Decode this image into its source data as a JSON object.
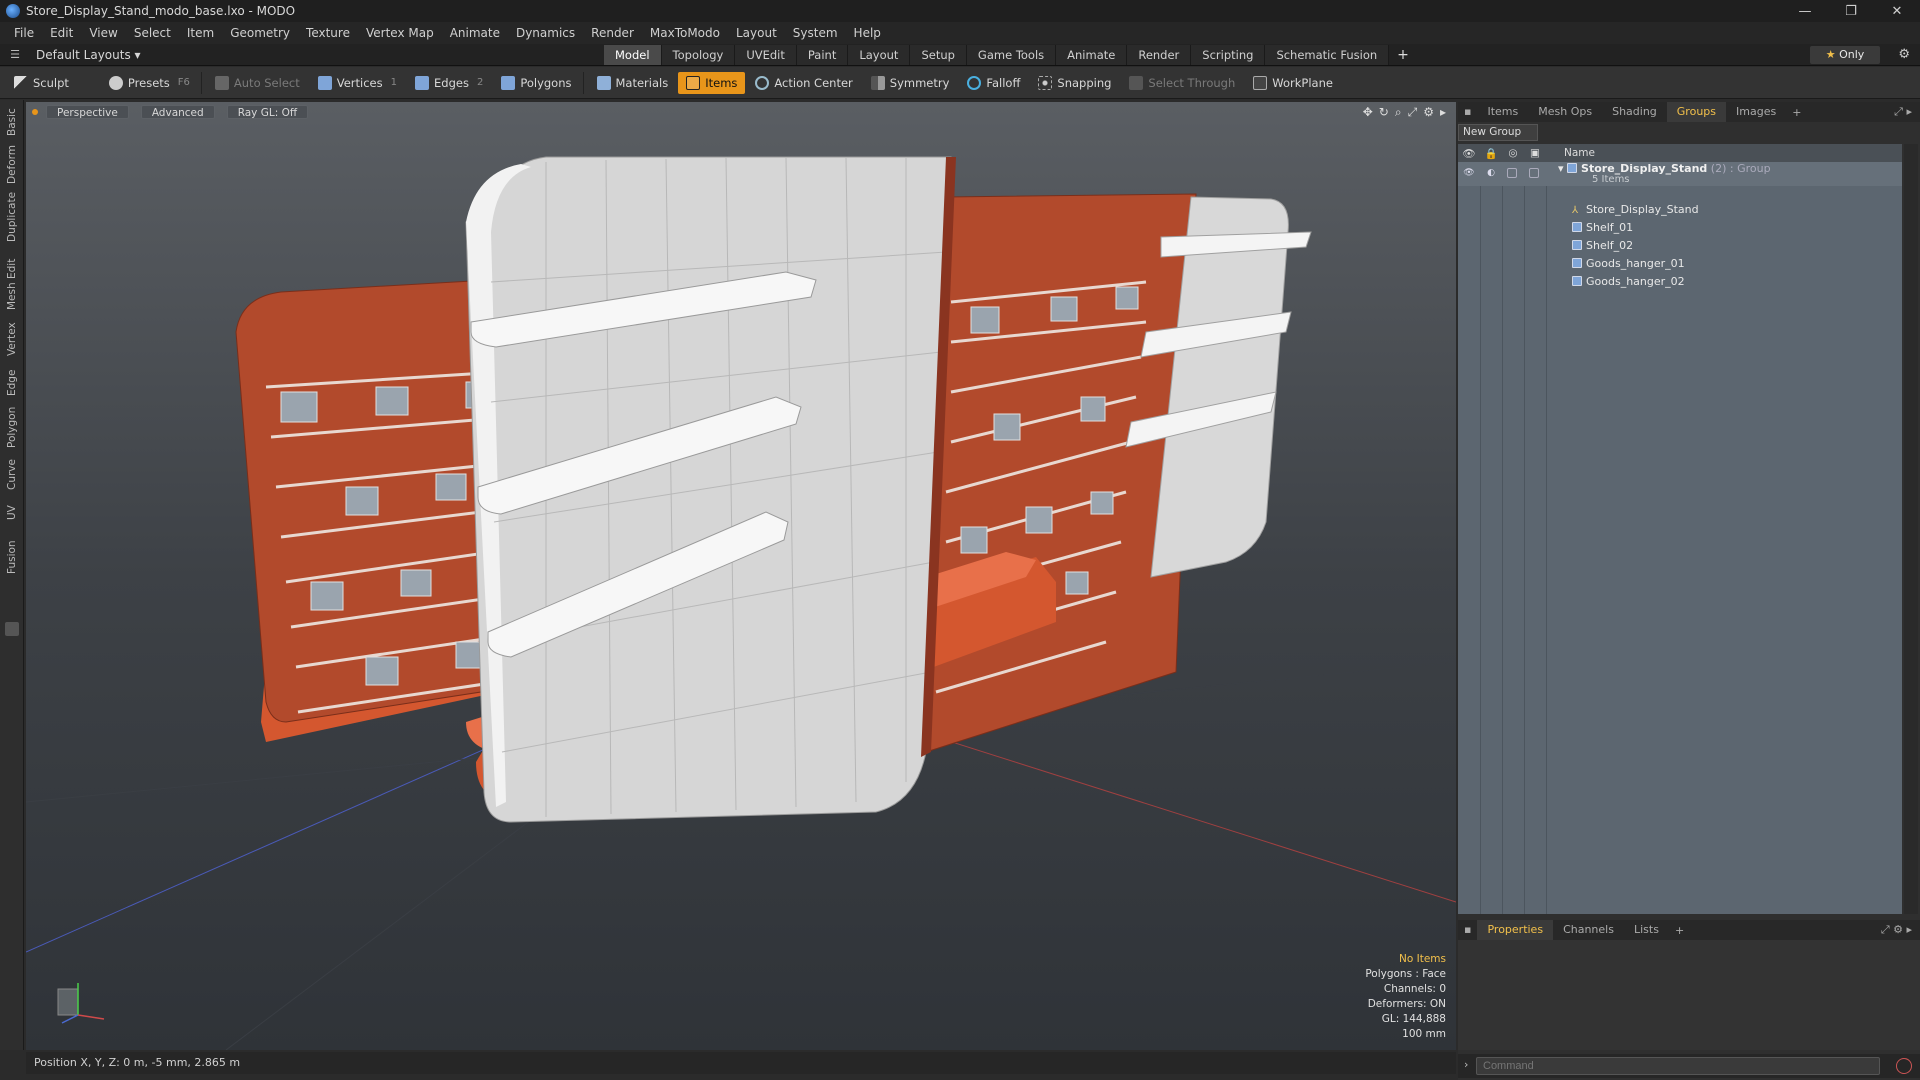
{
  "window": {
    "title": "Store_Display_Stand_modo_base.lxo - MODO",
    "controls": [
      "—",
      "❐",
      "✕"
    ]
  },
  "menu": [
    "File",
    "Edit",
    "View",
    "Select",
    "Item",
    "Geometry",
    "Texture",
    "Vertex Map",
    "Animate",
    "Dynamics",
    "Render",
    "MaxToModo",
    "Layout",
    "System",
    "Help"
  ],
  "layoutbar": {
    "layout_select": "Default Layouts ▾",
    "tabs": [
      "Model",
      "Topology",
      "UVEdit",
      "Paint",
      "Layout",
      "Setup",
      "Game Tools",
      "Animate",
      "Render",
      "Scripting",
      "Schematic Fusion"
    ],
    "active_tab": "Model",
    "only_label": "Only"
  },
  "toolbar": {
    "sculpt": "Sculpt",
    "presets": "Presets",
    "presets_key": "F6",
    "auto_select": "Auto Select",
    "vertices": "Vertices",
    "vertices_num": "1",
    "edges": "Edges",
    "edges_num": "2",
    "polygons": "Polygons",
    "materials": "Materials",
    "items": "Items",
    "action_center": "Action Center",
    "symmetry": "Symmetry",
    "falloff": "Falloff",
    "snapping": "Snapping",
    "select_through": "Select Through",
    "workplane": "WorkPlane"
  },
  "left_tabs": [
    "Basic",
    "Deform",
    "Duplicate",
    "Mesh Edit",
    "Vertex",
    "Edge",
    "Polygon",
    "Curve",
    "UV",
    "Fusion"
  ],
  "viewport": {
    "view": "Perspective",
    "shading": "Advanced",
    "raygl": "Ray GL: Off",
    "info": {
      "no_items": "No Items",
      "polygons": "Polygons : Face",
      "channels": "Channels: 0",
      "deformers": "Deformers: ON",
      "gl": "GL: 144,888",
      "scale": "100 mm"
    }
  },
  "status": "Position X, Y, Z:  0 m, -5 mm, 2.865 m",
  "right_panel": {
    "tabs": [
      "Items",
      "Mesh Ops",
      "Shading",
      "Groups",
      "Images"
    ],
    "active_tab": "Groups",
    "new_group": "New Group",
    "name_header": "Name",
    "group": {
      "name": "Store_Display_Stand",
      "info": " (2) : Group",
      "count": "5 Items"
    },
    "items": [
      "Store_Display_Stand",
      "Shelf_01",
      "Shelf_02",
      "Goods_hanger_01",
      "Goods_hanger_02"
    ],
    "props_tabs": [
      "Properties",
      "Channels",
      "Lists"
    ],
    "props_active": "Properties",
    "command_placeholder": "Command"
  },
  "colors": {
    "accent": "#e8951a",
    "panel_red": "#b84a2e",
    "base_orange": "#e06a48",
    "panel_white": "#d8d8d8"
  }
}
